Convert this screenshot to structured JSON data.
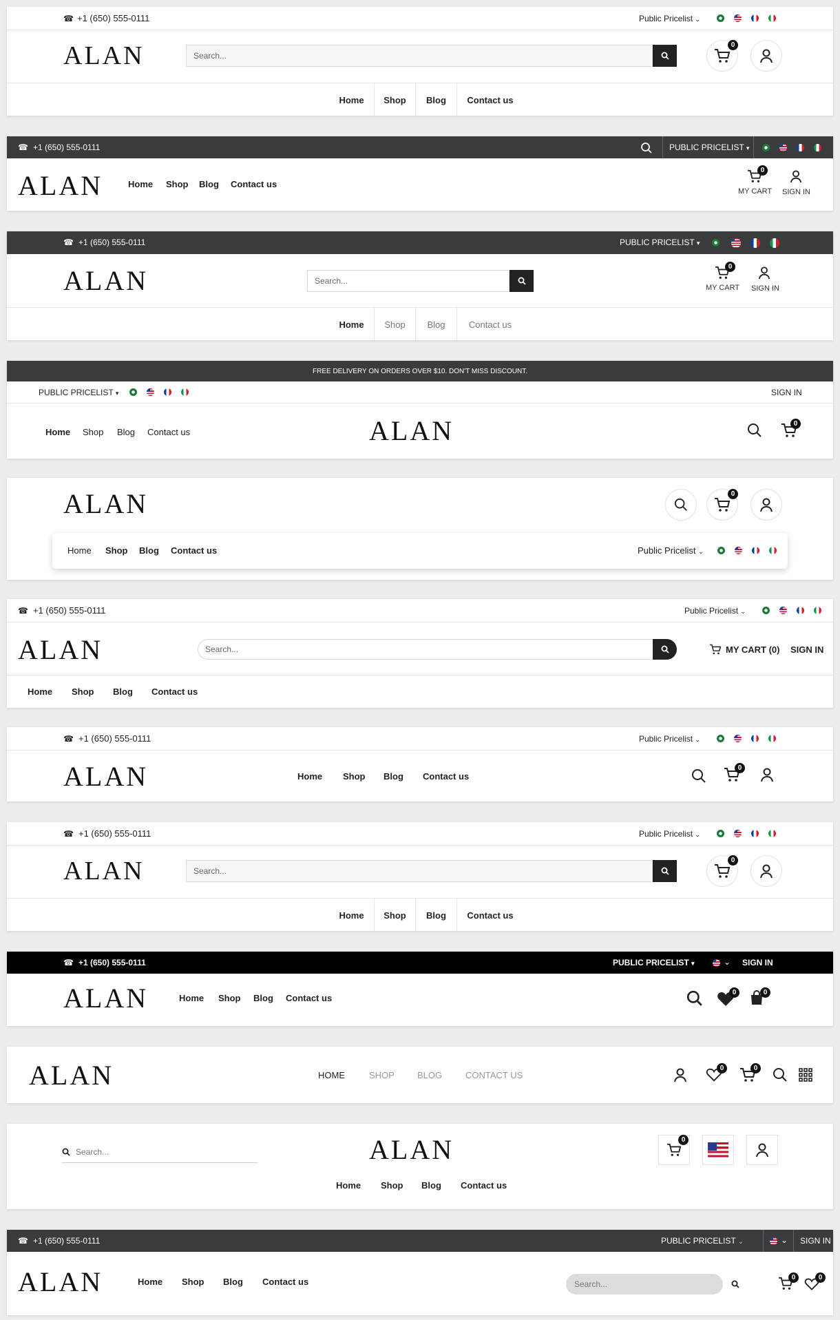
{
  "brand": {
    "logo": "ALAN",
    "phone": "+1 (650) 555-0111"
  },
  "nav": {
    "home": "Home",
    "shop": "Shop",
    "blog": "Blog",
    "contact": "Contact us"
  },
  "nav_upper": {
    "home": "HOME",
    "shop": "SHOP",
    "blog": "BLOG",
    "contact": "CONTACT US"
  },
  "pricelist": {
    "title": "Public Pricelist",
    "upper": "PUBLIC PRICELIST"
  },
  "search": {
    "placeholder": "Search..."
  },
  "account": {
    "my_cart": "MY CART",
    "sign_in": "SIGN IN",
    "my_cart_count": "MY CART (0)"
  },
  "counts": {
    "cart": "0",
    "wishlist": "0"
  },
  "announcement": "FREE DELIVERY ON ORDERS OVER $10. DON'T MISS DISCOUNT.",
  "languages": [
    "arabic-flag",
    "english-us-flag",
    "french-flag",
    "italian-flag"
  ],
  "colors": {
    "dark_bar": "#3a3b3d",
    "black_bar": "#000000",
    "accent": "#222222"
  }
}
